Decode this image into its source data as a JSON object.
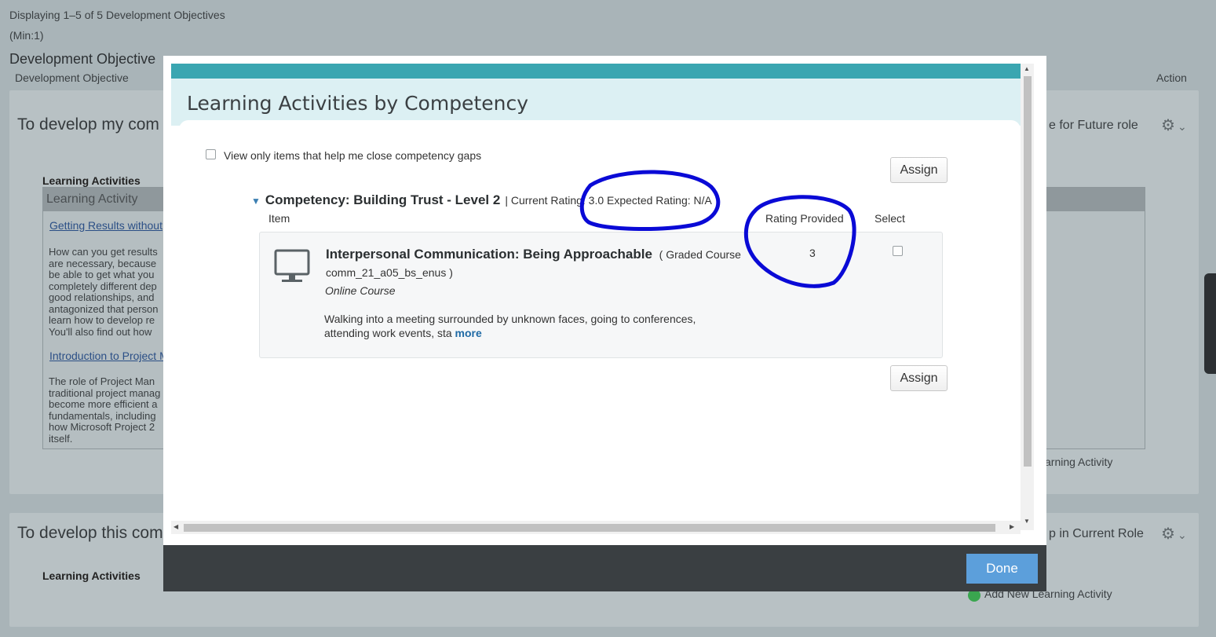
{
  "background": {
    "display_count": "Displaying 1–5 of 5 Development Objectives",
    "min_note": "(Min:1)",
    "section_title": "Development Objective",
    "column_objective": "Development Objective",
    "column_action": "Action",
    "objective1": {
      "heading": "To develop my com",
      "right_label": "e for Future role",
      "learning_activities_label": "Learning Activities",
      "table_head": "Learning Activity",
      "link1": "Getting Results without",
      "para1": "How can you get results are necessary, because be able to get what you completely different dep good relationships, and antagonized that person learn how to develop re You'll also find out how",
      "link2": "Introduction to Project M",
      "para2": "The role of Project Man traditional project manag become more efficient a fundamentals, including how Microsoft Project 2 itself.",
      "add_activity": "arning Activity"
    },
    "objective2": {
      "heading": "To develop this com",
      "right_label": "p in Current Role",
      "learning_activities_label": "Learning Activities",
      "add_activity": "Add New Learning Activity"
    }
  },
  "modal": {
    "title": "Learning Activities by Competency",
    "filter_label": "View only items that help me close competency gaps",
    "assign_label": "Assign",
    "competency": {
      "title": "Competency: Building Trust - Level 2",
      "meta": "| Current Rating: 3.0 Expected Rating: N/A"
    },
    "columns": {
      "item": "Item",
      "rating_provided": "Rating Provided",
      "select": "Select"
    },
    "item": {
      "title": "Interpersonal Communication: Being Approachable",
      "type": "( Graded Course",
      "code": "comm_21_a05_bs_enus )",
      "format": "Online Course",
      "description": "Walking into a meeting surrounded by unknown faces, going to conferences, attending work events, sta",
      "more_label": "more",
      "rating": "3",
      "icon": "monitor-icon"
    },
    "done_label": "Done"
  },
  "colors": {
    "teal_bar": "#3aa6b1",
    "header_tint": "#dcf0f3",
    "done_button": "#5c9fdb",
    "annotation": "#0a0ad6",
    "footer": "#3a3f42"
  }
}
